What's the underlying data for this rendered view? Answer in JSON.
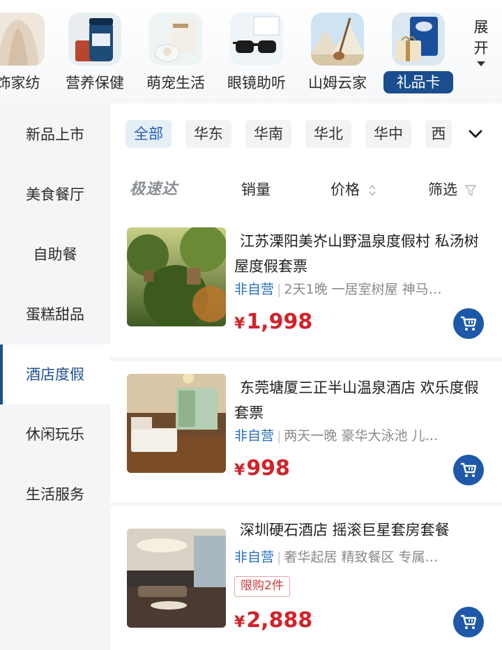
{
  "categories": [
    {
      "label": "饰家纺",
      "icon": "home-textile-icon"
    },
    {
      "label": "营养保健",
      "icon": "nutrition-icon"
    },
    {
      "label": "萌宠生活",
      "icon": "pet-icon"
    },
    {
      "label": "眼镜助听",
      "icon": "glasses-icon"
    },
    {
      "label": "山姆云家",
      "icon": "cloud-home-icon"
    },
    {
      "label": "礼品卡",
      "icon": "gift-card-icon",
      "active": true
    }
  ],
  "expand_label_1": "展",
  "expand_label_2": "开",
  "sidebar": {
    "items": [
      {
        "label": "新品上市"
      },
      {
        "label": "美食餐厅"
      },
      {
        "label": "自助餐"
      },
      {
        "label": "蛋糕甜品"
      },
      {
        "label": "酒店度假",
        "active": true
      },
      {
        "label": "休闲玩乐"
      },
      {
        "label": "生活服务"
      }
    ]
  },
  "regions": {
    "items": [
      "全部",
      "华东",
      "华南",
      "华北",
      "华中",
      "西"
    ],
    "selected": "全部"
  },
  "sort": {
    "express": "极速达",
    "sales": "销量",
    "price": "价格",
    "filter": "筛选"
  },
  "products": [
    {
      "title": "江苏溧阳美岕山野温泉度假村 私汤树屋度假套票",
      "seller": "非自营",
      "desc": "2天1晚 一居室树屋 神马…",
      "price": "1,998",
      "currency": "¥"
    },
    {
      "title": "东莞塘厦三正半山温泉酒店 欢乐度假套票",
      "seller": "非自营",
      "desc": "两天一晚 豪华大泳池 儿…",
      "price": "998",
      "currency": "¥"
    },
    {
      "title": "深圳硬石酒店 摇滚巨星套房套餐",
      "seller": "非自营",
      "desc": "奢华起居 精致餐区 专属…",
      "tag": "限购2件",
      "price": "2,888",
      "currency": "¥"
    }
  ],
  "colors": {
    "accent": "#1d59a8",
    "price": "#d2232a",
    "seller": "#2a6fbf"
  }
}
